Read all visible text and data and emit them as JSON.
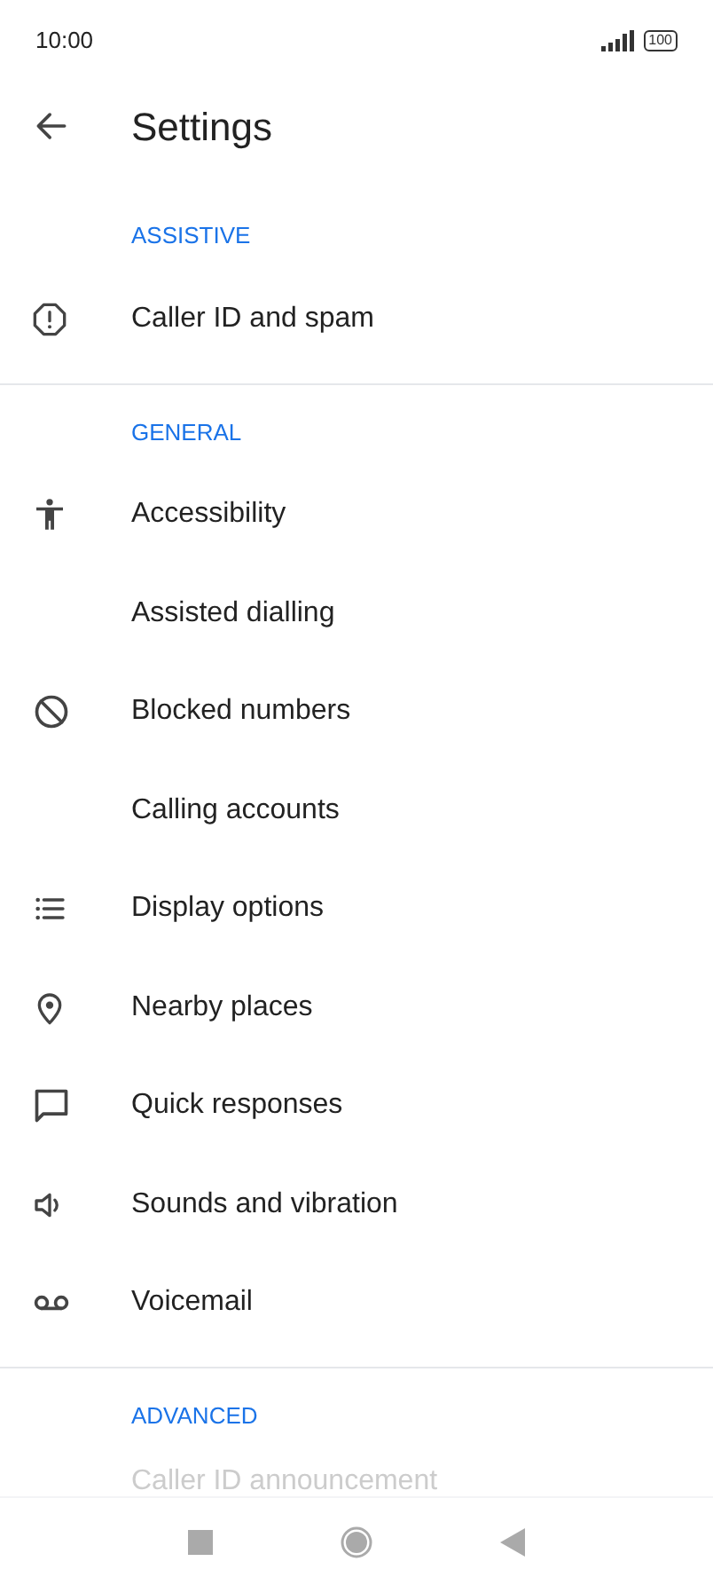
{
  "status_bar": {
    "time": "10:00",
    "battery": "100"
  },
  "header": {
    "title": "Settings"
  },
  "sections": [
    {
      "heading": "ASSISTIVE",
      "items": [
        "Caller ID and spam"
      ]
    },
    {
      "heading": "GENERAL",
      "items": [
        "Accessibility",
        "Assisted dialling",
        "Blocked numbers",
        "Calling accounts",
        "Display options",
        "Nearby places",
        "Quick responses",
        "Sounds and vibration",
        "Voicemail"
      ]
    },
    {
      "heading": "ADVANCED",
      "items": [
        "Caller ID announcement"
      ]
    }
  ]
}
